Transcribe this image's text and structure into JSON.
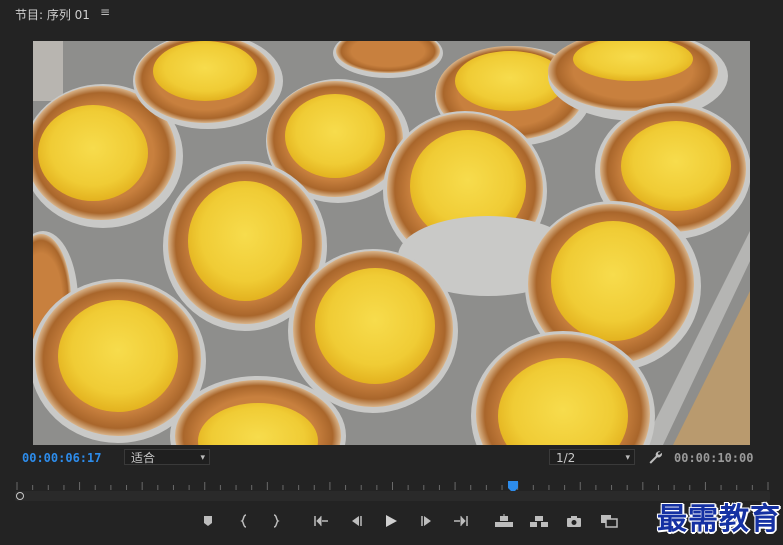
{
  "panel": {
    "title": "节目: 序列 01",
    "menu_icon": "hamburger-menu-icon"
  },
  "viewer": {
    "content": "photo",
    "content_alt": "egg-tarts-on-tray"
  },
  "controls": {
    "current_timecode": "00:00:06:17",
    "duration_timecode": "00:00:10:00",
    "fit_label": "适合",
    "resolution_label": "1/2",
    "playhead_position": 0.0,
    "marker_position": 0.66
  },
  "transport": {
    "buttons": [
      {
        "name": "add-marker-icon"
      },
      {
        "name": "mark-in-icon"
      },
      {
        "name": "mark-out-icon"
      },
      {
        "name": "go-to-in-icon"
      },
      {
        "name": "step-back-icon"
      },
      {
        "name": "play-icon"
      },
      {
        "name": "step-forward-icon"
      },
      {
        "name": "go-to-out-icon"
      },
      {
        "name": "lift-icon"
      },
      {
        "name": "extract-icon"
      },
      {
        "name": "export-frame-icon"
      },
      {
        "name": "comparison-view-icon"
      }
    ]
  },
  "watermark": {
    "text": "最需教育"
  },
  "colors": {
    "accent": "#2d8ceb",
    "background": "#232323",
    "watermark": "#1531a3"
  }
}
